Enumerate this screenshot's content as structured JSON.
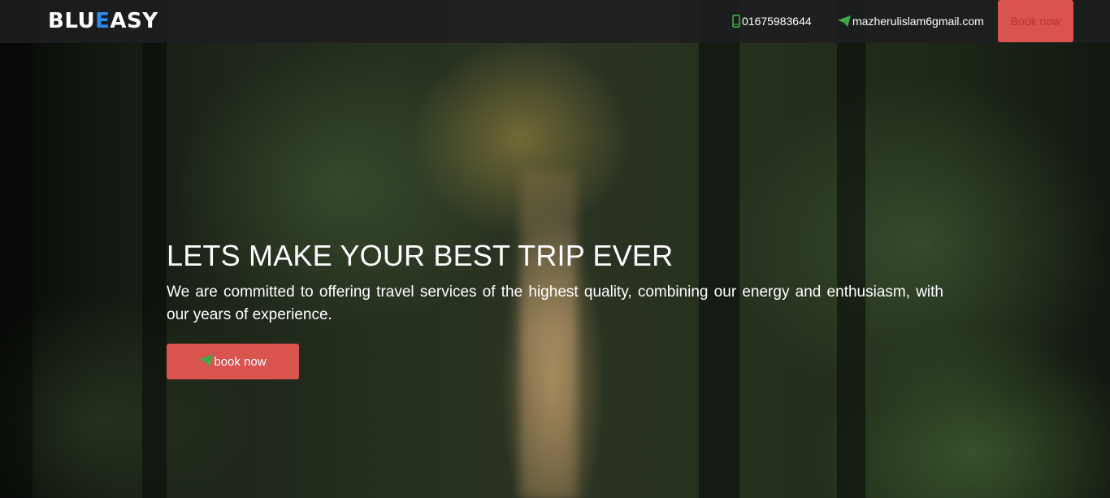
{
  "header": {
    "brand_prefix": "BLU",
    "brand_accent": "E",
    "brand_suffix": "ASY",
    "phone": "01675983644",
    "email": "mazherulislam6gmail.com",
    "book_label": "Book now"
  },
  "hero": {
    "headline": "LETS MAKE YOUR BEST TRIP EVER",
    "tagline": "We are committed to offering travel services of the highest quality, combining our energy and enthusiasm, with our years of experience.",
    "cta_label": "book now",
    "background": "forest-photo"
  },
  "icons": {
    "phone": "mobile-phone-icon",
    "email": "paper-plane-icon",
    "cta": "paper-plane-icon"
  },
  "colors": {
    "brand_accent": "#2e8cf0",
    "button_red": "#d9534f",
    "icon_green": "#3fae49",
    "navbar": "#1e1e20"
  }
}
